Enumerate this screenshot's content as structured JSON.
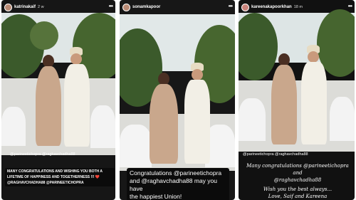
{
  "stories": [
    {
      "username": "katrinakaif",
      "time": "2 w",
      "tags": "@parineetichopra @raghavchadha88",
      "caption_lines": [
        "MANY CONGRATULATIONS AND WISHING YOU BOTH A",
        "LIFETIME OF HAPPINESS AND TOGETHERNESS !!! ❤️",
        "@RAGHAVCHADHA88 @PARINEETICHOPRA"
      ]
    },
    {
      "username": "sonamkapoor",
      "time": "",
      "tags": "",
      "caption_lines": [
        "Congratulations @parineetichopra",
        "and @raghavchadha88 may you have",
        "the happiest Union!"
      ]
    },
    {
      "username": "kareenakapoorkhan",
      "time": "18 m",
      "tags": "@parineetichopra @raghavchadha88",
      "caption_lines": [
        "Many congratulations @parineetichopra and",
        "@raghavchadha88",
        "Wish you the best always...",
        "Love, Saif and Kareena"
      ]
    }
  ],
  "icons": [
    "more-options-icon",
    "avatar"
  ],
  "colors": {
    "sky": "#dfe6e6",
    "foliage": "#3f5f2e",
    "lehenga": "#c9a78c",
    "sherwani": "#f2efe6",
    "flowers": "#f4f4f4",
    "caption_box": "#0b0b0b"
  }
}
